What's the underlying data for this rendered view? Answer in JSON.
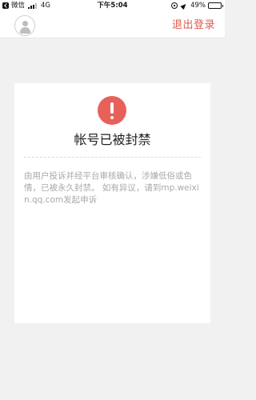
{
  "status_bar": {
    "app": "微信",
    "network": "4G",
    "time": "下午5:04",
    "battery": "49%",
    "battery_level": 0.49
  },
  "nav": {
    "logout_label": "退出登录"
  },
  "card": {
    "title": "帐号已被封禁",
    "description": "由用户投诉并经平台审核确认，涉嫌低俗或色情，已被永久封禁。 如有异议，请到mp.weixin.qq.com发起申诉"
  },
  "colors": {
    "accent": "#e0594f",
    "alert": "#e8605a",
    "background": "#f1f1f1"
  }
}
